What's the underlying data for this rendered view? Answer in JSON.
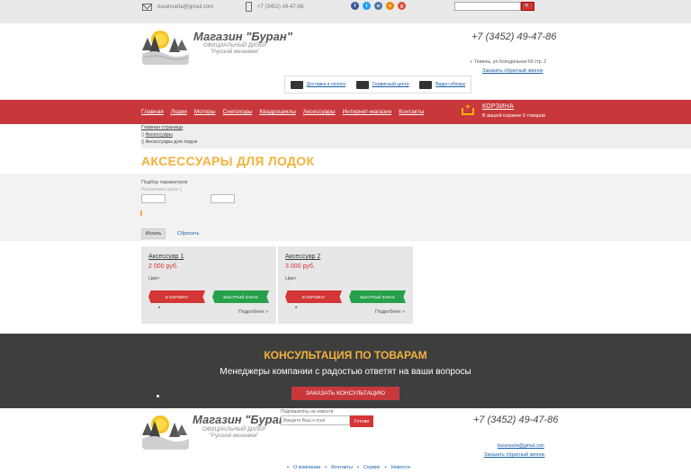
{
  "topbar": {
    "email": "buranvarta@gmail.com",
    "phone": "+7 (3452) 49-47-86",
    "socials": [
      {
        "icon": "facebook-icon",
        "glyph": "f",
        "color": "#3b5998"
      },
      {
        "icon": "twitter-icon",
        "glyph": "t",
        "color": "#1da1f2"
      },
      {
        "icon": "vk-icon",
        "glyph": "в",
        "color": "#4c75a3"
      },
      {
        "icon": "odnoklassniki-icon",
        "glyph": "о",
        "color": "#ee8208"
      },
      {
        "icon": "googleplus-icon",
        "glyph": "g",
        "color": "#dd4b39"
      }
    ],
    "search_placeholder": ""
  },
  "header": {
    "logo_title": "Магазин \"Буран\"",
    "logo_sub1": "ОФИЦИАЛЬНЫЙ ДИЛЕР",
    "logo_sub2": "\"Русской механики\"",
    "phone": "+7 (3452) 49-47-86",
    "address": "г. Тюмень, ул.Холодильная 66 стр. 2",
    "callback": "Заказать обратный звонок",
    "services": [
      {
        "icon": "truck-icon",
        "label": "Доставка и оплата"
      },
      {
        "icon": "service-center-icon",
        "label": "Сервисный центр"
      },
      {
        "icon": "video-icon",
        "label": "Видео обзоры"
      }
    ]
  },
  "nav": {
    "items": [
      "Главная",
      "Лодки",
      "Моторы",
      "Снегоходы",
      "Квадроциклы",
      "Аксессуары",
      "Интернет-магазин",
      "Контакты"
    ]
  },
  "cart": {
    "title": "КОРЗИНА",
    "text": "В вашей корзине 0 товаров"
  },
  "breadcrumbs": [
    "Главная страница",
    "Аксессуары",
    "Аксессуары для лодок"
  ],
  "page_title": "АКСЕССУАРЫ ДЛЯ ЛОДОК",
  "filter": {
    "title": "Подбор параметров",
    "price_label": "Розничная цена",
    "search_btn": "Искать",
    "reset_btn": "Сбросить"
  },
  "products": [
    {
      "name": "Аксессуар 1",
      "price": "2 000 руб.",
      "color_label": "Цвет",
      "cart_btn": "В КОРЗИНУ",
      "fast_btn": "БЫСТРЫЙ ЗАКАЗ",
      "more": "Подробнее »"
    },
    {
      "name": "Аксессуар 2",
      "price": "3 000 руб.",
      "color_label": "Цвет",
      "cart_btn": "В КОРЗИНУ",
      "fast_btn": "БЫСТРЫЙ ЗАКАЗ",
      "more": "Подробнее »"
    }
  ],
  "consult": {
    "title": "КОНСУЛЬТАЦИЯ ПО ТОВАРАМ",
    "text": "Менеджеры компании с радостью ответят на ваши вопросы",
    "button": "ЗАКАЗАТЬ КОНСУЛЬТАЦИЮ"
  },
  "footer": {
    "logo_title": "Магазин \"Буран\"",
    "logo_sub1": "ОФИЦИАЛЬНЫЙ ДИЛЕР",
    "logo_sub2": "\"Русской механики\"",
    "news_label": "Подпишитесь на новости",
    "news_placeholder": "Введите Ваш e-mail",
    "news_button": "Готово",
    "phone": "+7 (3452) 49-47-86",
    "email": "buranvarta@gmail.com",
    "callback": "Заказать обратный звонок",
    "links": [
      "О компании",
      "Контакты",
      "Сервис",
      "Новости"
    ]
  }
}
